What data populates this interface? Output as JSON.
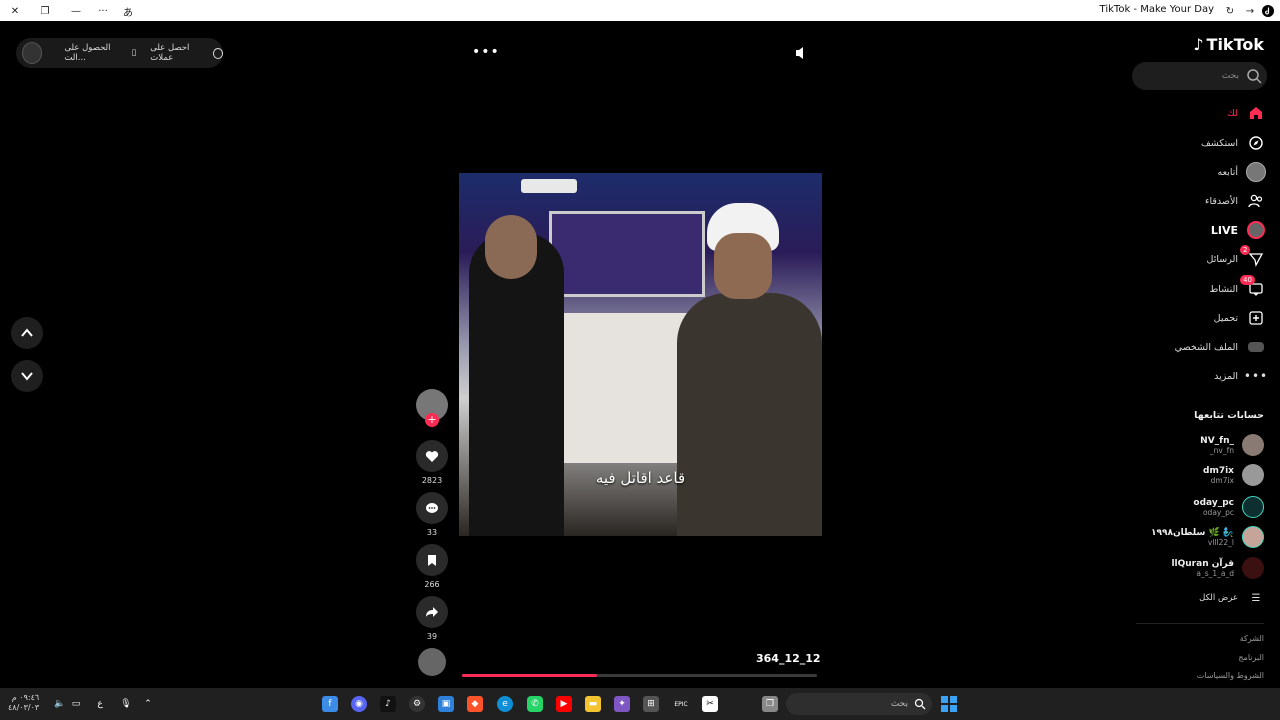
{
  "window": {
    "title": "TikTok - Make Your Day"
  },
  "brand": {
    "name": "TikTok"
  },
  "search": {
    "placeholder": "بحث"
  },
  "top_left": {
    "get_coins": "احصل على عملات",
    "get_app": "الحصول على الت..."
  },
  "nav": [
    {
      "label": "لك",
      "icon": "home-icon",
      "active": true
    },
    {
      "label": "استكشف",
      "icon": "compass-icon"
    },
    {
      "label": "أتابعه",
      "icon": "avatar-icon"
    },
    {
      "label": "الأصدقاء",
      "icon": "friends-icon"
    },
    {
      "label": "LIVE",
      "icon": "live-icon"
    },
    {
      "label": "الرسائل",
      "icon": "messages-icon",
      "badge": "2"
    },
    {
      "label": "النشاط",
      "icon": "activity-icon",
      "badge": "40"
    },
    {
      "label": "تحميل",
      "icon": "upload-icon"
    },
    {
      "label": "الملف الشخصي",
      "icon": "profile-icon"
    },
    {
      "label": "المزيد",
      "icon": "more-icon"
    }
  ],
  "following": {
    "title": "حسابات تتابعها",
    "accounts": [
      {
        "name": "NV_fn_",
        "handle": "_nv_fn"
      },
      {
        "name": "dm7ix",
        "handle": "dm7ix"
      },
      {
        "name": "oday_pc",
        "handle": "oday_pc"
      },
      {
        "name": "سلطان١٩٩٨ 🌿 🧞‍♂️",
        "handle": "vlll22_l"
      },
      {
        "name": "llQuran قرآن",
        "handle": "a_s_1_a_d"
      }
    ],
    "see_all": "عرض الكل"
  },
  "footer": [
    "الشركة",
    "البرنامج",
    "الشروط والسياسات"
  ],
  "video": {
    "caption": "قاعد اقاتل فيه",
    "author": "364_12_12",
    "progress": 0.38
  },
  "actions": {
    "likes": "2823",
    "comments": "33",
    "saves": "266",
    "shares": "39"
  },
  "taskbar": {
    "search_placeholder": "بحث",
    "time": "٠٩:٤٦ م",
    "date": "٤٨/٠٣/٠٣",
    "lang": "ع"
  },
  "colors": {
    "accent": "#fe2c55",
    "background": "#000000",
    "sidebar": "#000000"
  }
}
